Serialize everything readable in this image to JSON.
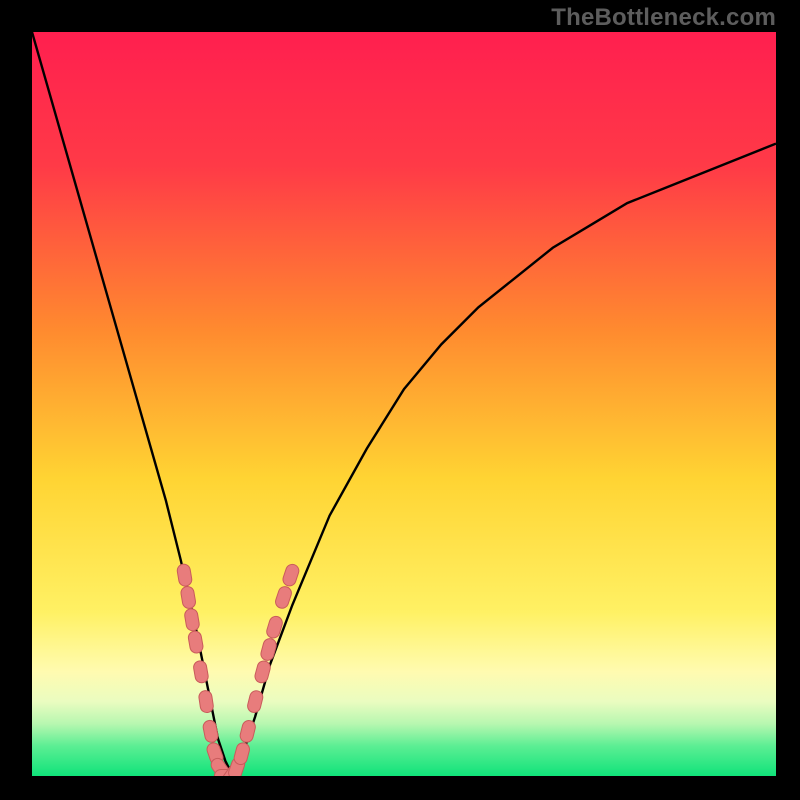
{
  "watermark": {
    "text": "TheBottleneck.com"
  },
  "colors": {
    "frame": "#000000",
    "gradient_stops": [
      {
        "pct": 0,
        "color": "#ff1f4f"
      },
      {
        "pct": 18,
        "color": "#ff3a47"
      },
      {
        "pct": 40,
        "color": "#ff8a2f"
      },
      {
        "pct": 60,
        "color": "#ffd433"
      },
      {
        "pct": 78,
        "color": "#fff164"
      },
      {
        "pct": 86,
        "color": "#fffbb0"
      },
      {
        "pct": 90,
        "color": "#eafcc0"
      },
      {
        "pct": 93,
        "color": "#b7f7b0"
      },
      {
        "pct": 96,
        "color": "#5bee93"
      },
      {
        "pct": 100,
        "color": "#10e37a"
      }
    ],
    "curve": "#000000",
    "marker_fill": "#e87c7c",
    "marker_stroke": "#c95b5b"
  },
  "chart_data": {
    "type": "line",
    "title": "",
    "xlabel": "",
    "ylabel": "",
    "xlim": [
      0,
      100
    ],
    "ylim": [
      0,
      100
    ],
    "series": [
      {
        "name": "bottleneck-curve",
        "x": [
          0,
          2,
          4,
          6,
          8,
          10,
          12,
          14,
          16,
          18,
          20,
          22,
          24,
          25,
          26,
          27,
          28,
          30,
          32,
          35,
          40,
          45,
          50,
          55,
          60,
          65,
          70,
          75,
          80,
          85,
          90,
          95,
          100
        ],
        "values": [
          100,
          93,
          86,
          79,
          72,
          65,
          58,
          51,
          44,
          37,
          29,
          20,
          10,
          5,
          2,
          0,
          2,
          8,
          15,
          23,
          35,
          44,
          52,
          58,
          63,
          67,
          71,
          74,
          77,
          79,
          81,
          83,
          85
        ]
      }
    ],
    "markers": {
      "name": "highlighted-range",
      "points": [
        {
          "x": 20.5,
          "y": 27
        },
        {
          "x": 21.0,
          "y": 24
        },
        {
          "x": 21.5,
          "y": 21
        },
        {
          "x": 22.0,
          "y": 18
        },
        {
          "x": 22.7,
          "y": 14
        },
        {
          "x": 23.4,
          "y": 10
        },
        {
          "x": 24.0,
          "y": 6
        },
        {
          "x": 24.6,
          "y": 3
        },
        {
          "x": 25.3,
          "y": 1
        },
        {
          "x": 26.0,
          "y": 0
        },
        {
          "x": 26.8,
          "y": 0
        },
        {
          "x": 27.5,
          "y": 1
        },
        {
          "x": 28.2,
          "y": 3
        },
        {
          "x": 29.0,
          "y": 6
        },
        {
          "x": 30.0,
          "y": 10
        },
        {
          "x": 31.0,
          "y": 14
        },
        {
          "x": 31.8,
          "y": 17
        },
        {
          "x": 32.6,
          "y": 20
        },
        {
          "x": 33.8,
          "y": 24
        },
        {
          "x": 34.8,
          "y": 27
        }
      ]
    }
  }
}
